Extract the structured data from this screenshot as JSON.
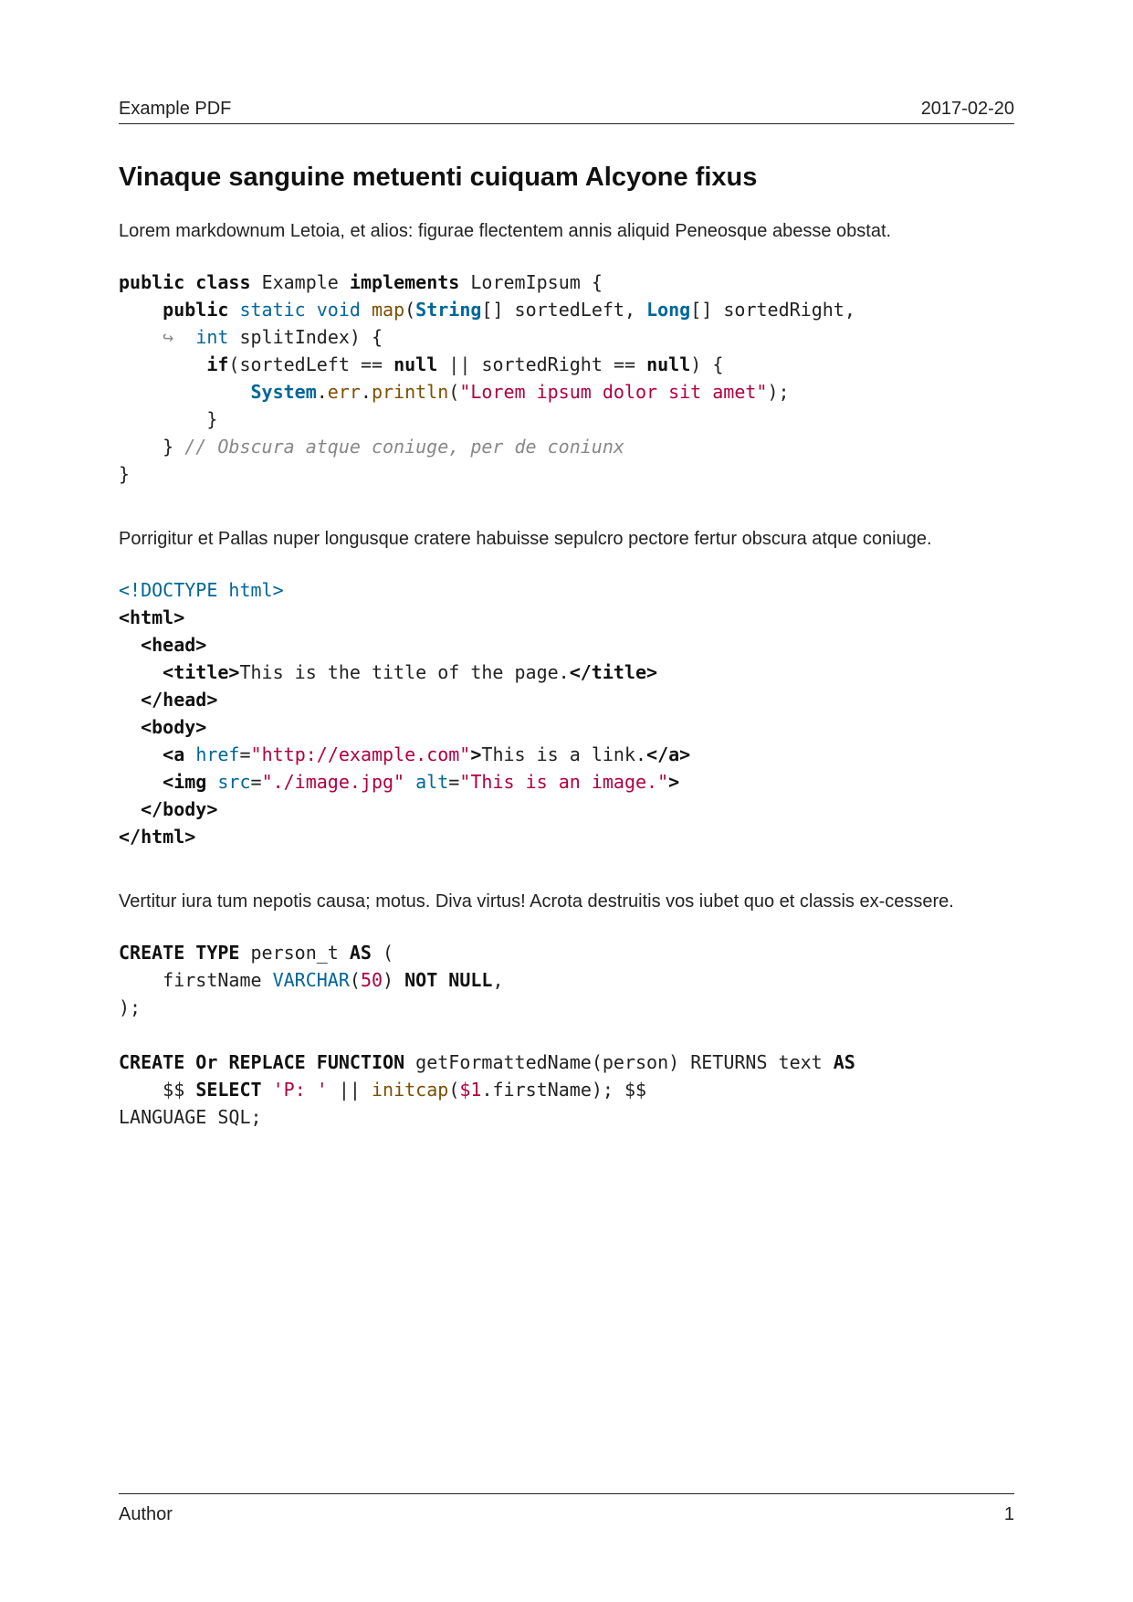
{
  "header": {
    "left": "Example PDF",
    "right": "2017-02-20"
  },
  "title": "Vinaque sanguine metuenti cuiquam Alcyone fixus",
  "para1": "Lorem markdownum Letoia, et alios: figurae flectentem annis aliquid Peneosque abesse obstat.",
  "para2": "Porrigitur et Pallas nuper longusque cratere habuisse sepulcro pectore fertur obscura atque coniuge.",
  "para3": "Vertitur iura tum nepotis causa; motus.  Diva virtus! Acrota destruitis vos iubet quo et classis ex-cessere.",
  "footer": {
    "left": "Author",
    "right": "1"
  },
  "code_java": {
    "t": {
      "public": "public",
      "class": "class",
      "example": "Example",
      "implements": "implements",
      "loremipsum": "LoremIpsum",
      "lbrace": "{",
      "rbrace": "}",
      "static": "static",
      "void": "void",
      "map": "map",
      "string": "String",
      "brackets": "[]",
      "sortedLeft": "sortedLeft",
      "long": "Long",
      "sortedRight": "sortedRight",
      "comma": ",",
      "arrow": "↪",
      "int": "int",
      "splitIndex": "splitIndex",
      "rparen_open": ")",
      "lbrace2": "{",
      "if": "if",
      "lparen": "(",
      "eq": "==",
      "null": "null",
      "oror": "||",
      "rparen": ")",
      "system": "System",
      "dot": ".",
      "err": "err",
      "println": "println",
      "strlit": "\"Lorem ipsum dolor sit amet\"",
      "semi": ";",
      "comment": "// Obscura atque coniuge, per de coniunx"
    }
  },
  "code_html": {
    "t": {
      "doctype": "<!DOCTYPE html>",
      "html_o": "<html>",
      "html_c": "</html>",
      "head_o": "<head>",
      "head_c": "</head>",
      "title_o": "<title>",
      "title_c": "</title>",
      "title_txt": "This is the title of the page.",
      "body_o": "<body>",
      "body_c": "</body>",
      "a_o1": "<a",
      "href": "href",
      "eq": "=",
      "url": "\"http://example.com\"",
      "gt": ">",
      "a_txt": "This is a link.",
      "a_c": "</a>",
      "img_o": "<img",
      "src": "src",
      "srcval": "\"./image.jpg\"",
      "alt": "alt",
      "altval": "\"This is an image.\"",
      "img_c": ">"
    }
  },
  "code_sql": {
    "t": {
      "create": "CREATE",
      "type": "TYPE",
      "person_t": "person_t",
      "as": "AS",
      "lparen": "(",
      "rparen": ")",
      "firstName": "firstName",
      "varchar": "VARCHAR",
      "n50": "50",
      "notnull": "NOT NULL",
      "comma": ",",
      "semi": ";",
      "or": "Or",
      "replace": "REPLACE",
      "function": "FUNCTION",
      "getFormattedName": "getFormattedName",
      "person": "person",
      "returns": "RETURNS",
      "text": "text",
      "dollars": "$$",
      "select": "SELECT",
      "plit": "'P: '",
      "concat": "||",
      "initcap": "initcap",
      "arg1": "$1",
      "dot": ".",
      "language": "LANGUAGE SQL;"
    }
  }
}
